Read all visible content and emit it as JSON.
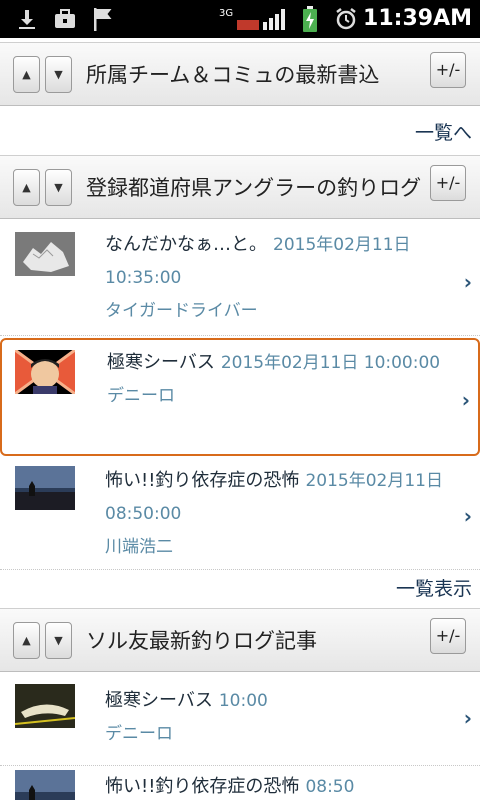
{
  "status_bar": {
    "time": "11:39AM",
    "network": "3G",
    "icons": [
      "download-icon",
      "briefcase-icon",
      "flag-icon",
      "signal-icon",
      "battery-charging-icon",
      "alarm-icon"
    ]
  },
  "sections": [
    {
      "title": "所属チーム＆コミュの最新書込",
      "pm_label": "+/-",
      "up_label": "▲",
      "down_label": "▼",
      "more_label": "一覧へ"
    },
    {
      "title": "登録都道府県アングラーの釣りログ",
      "pm_label": "+/-",
      "up_label": "▲",
      "down_label": "▼",
      "more_label": "一覧表示",
      "items": [
        {
          "title": "なんだかなぁ…と。",
          "date": "2015年02月11日 10:35:00",
          "author": "タイガードライバー",
          "thumb": "crushed-can-photo"
        },
        {
          "title": "極寒シーバス",
          "date": "2015年02月11日 10:00:00",
          "author": "デニーロ",
          "thumb": "cartoon-face-photo"
        },
        {
          "title": "怖い!!釣り依存症の恐怖",
          "date": "2015年02月11日 08:50:00",
          "author": "川端浩二",
          "thumb": "shoreline-silhouette-photo"
        }
      ]
    },
    {
      "title": "ソル友最新釣りログ記事",
      "pm_label": "+/-",
      "up_label": "▲",
      "down_label": "▼",
      "items": [
        {
          "title": "極寒シーバス",
          "date": "10:00",
          "author": "デニーロ",
          "thumb": "fish-photo"
        },
        {
          "title": "怖い!!釣り依存症の恐怖",
          "date": "08:50",
          "author": "",
          "thumb": "shoreline-silhouette-photo"
        }
      ]
    }
  ],
  "chevron": "›"
}
